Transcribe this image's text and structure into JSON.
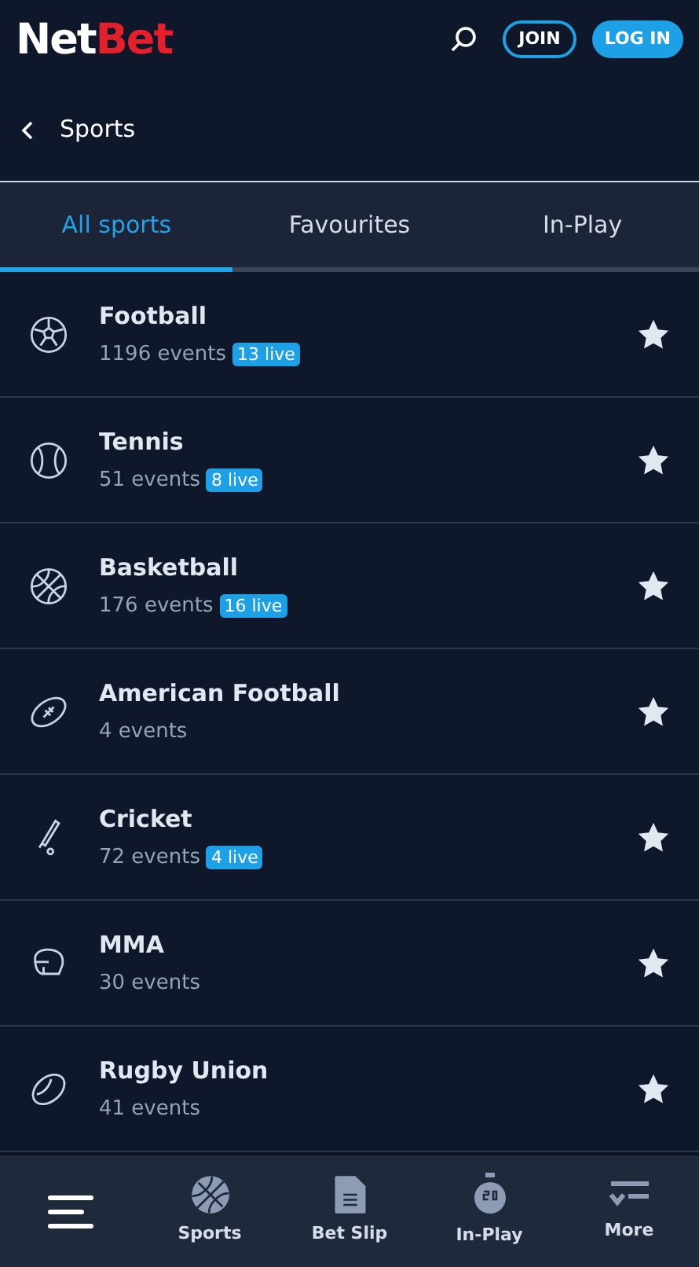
{
  "header": {
    "logo": {
      "part_1": "Net",
      "part_2": "Bet"
    },
    "join": "JOIN",
    "login": "LOG IN"
  },
  "subheader": {
    "title": "Sports"
  },
  "tabs": [
    {
      "label": "All sports",
      "selected": true
    },
    {
      "label": "Favourites",
      "selected": false
    },
    {
      "label": "In-Play",
      "selected": false
    }
  ],
  "sports": [
    {
      "name": "Football",
      "events": "1196 events",
      "live": "13 live"
    },
    {
      "name": "Tennis",
      "events": "51 events",
      "live": "8 live"
    },
    {
      "name": "Basketball",
      "events": "176 events",
      "live": "16 live"
    },
    {
      "name": "American Football",
      "events": "4 events"
    },
    {
      "name": "Cricket",
      "events": "72 events",
      "live": "4 live"
    },
    {
      "name": "MMA",
      "events": "30 events"
    },
    {
      "name": "Rugby Union",
      "events": "41 events"
    }
  ],
  "bottom_nav": [
    {
      "label": "Sports"
    },
    {
      "label": "Bet Slip"
    },
    {
      "label": "In-Play"
    },
    {
      "label": "More"
    }
  ]
}
